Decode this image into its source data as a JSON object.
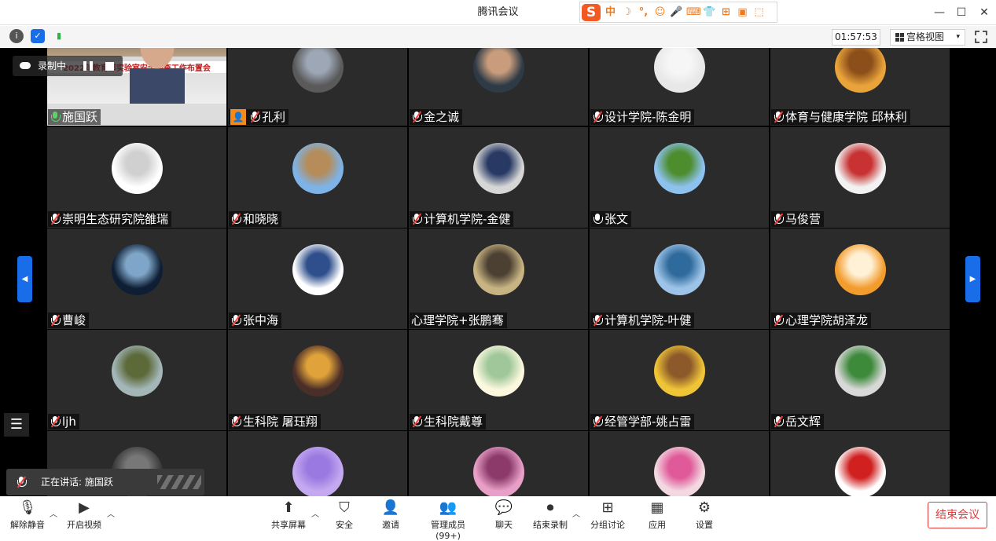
{
  "window": {
    "title": "腾讯会议",
    "minimize": "—",
    "maximize": "☐",
    "close": "✕"
  },
  "ime": {
    "logo": "S",
    "items": [
      "中",
      "☽",
      "°,",
      "☺",
      "🎤",
      "⌨",
      "👕",
      "⊞",
      "▣",
      "⬚"
    ]
  },
  "infobar": {
    "timer": "01:57:53",
    "view_label": "宫格视图",
    "view_caret": "▾"
  },
  "recording": {
    "label": "录制中"
  },
  "speaking": {
    "label": "正在讲话: 施国跃"
  },
  "colors": {
    "accent": "#1a6de8",
    "end": "#e03c3c",
    "mic_active": "#5fcf6a",
    "mic_muted": "#f04040"
  },
  "participants": [
    {
      "name": "施国跃",
      "mic": "on",
      "video": true,
      "slide_title": "2022年教育部实验室安全检查工作布置会"
    },
    {
      "name": "孔利",
      "mic": "off",
      "avatar": [
        "#5a5a5a",
        "#9da7b6"
      ],
      "badge": true
    },
    {
      "name": "金之诚",
      "mic": "off",
      "avatar": [
        "#2e3a46",
        "#c89c7c"
      ]
    },
    {
      "name": "设计学院-陈金明",
      "mic": "off",
      "avatar": [
        "#e8e8e8",
        "#f6f6f6"
      ]
    },
    {
      "name": "体育与健康学院 邱林利",
      "mic": "off",
      "avatar": [
        "#e8a33a",
        "#8c4e1a"
      ]
    },
    {
      "name": "崇明生态研究院雒瑞",
      "mic": "off",
      "avatar": [
        "#ffffff",
        "#d0d0d0"
      ]
    },
    {
      "name": "和晓晓",
      "mic": "off",
      "avatar": [
        "#7db3e6",
        "#b58c5a"
      ]
    },
    {
      "name": "计算机学院-金健",
      "mic": "off",
      "avatar": [
        "#d6d6d6",
        "#283a64"
      ]
    },
    {
      "name": "张文",
      "mic": "on-white",
      "avatar": [
        "#8dc2ef",
        "#4d8d2e"
      ]
    },
    {
      "name": "马俊营",
      "mic": "off",
      "avatar": [
        "#f2f2f2",
        "#c83232"
      ]
    },
    {
      "name": "曹峻",
      "mic": "off",
      "avatar": [
        "#0e1e34",
        "#7fa6c8"
      ]
    },
    {
      "name": "张中海",
      "mic": "off",
      "avatar": [
        "#ffffff",
        "#2e4f8c"
      ]
    },
    {
      "name": "心理学院+张鹏骞",
      "mic": "none",
      "avatar": [
        "#c7b482",
        "#4c4032"
      ]
    },
    {
      "name": "计算机学院-叶健",
      "mic": "off",
      "avatar": [
        "#9dc4e8",
        "#2f6a9c"
      ]
    },
    {
      "name": "心理学院胡泽龙",
      "mic": "off",
      "avatar": [
        "#f39c2e",
        "#fff1d6"
      ]
    },
    {
      "name": "ljh",
      "mic": "off",
      "avatar": [
        "#a4b6b8",
        "#5c6a3a"
      ]
    },
    {
      "name": "生科院 屠珏翔",
      "mic": "off",
      "avatar": [
        "#4a2e28",
        "#e0a23a"
      ]
    },
    {
      "name": "生科院戴尊",
      "mic": "off",
      "avatar": [
        "#fbf8de",
        "#9fc79a"
      ]
    },
    {
      "name": "经管学部-姚占雷",
      "mic": "off",
      "avatar": [
        "#f0c437",
        "#8c5a2a"
      ]
    },
    {
      "name": "岳文辉",
      "mic": "off",
      "avatar": [
        "#d8d8d8",
        "#3c8a3a"
      ]
    },
    {
      "name": "",
      "mic": "none",
      "avatar": [
        "#3a3a3a",
        "#777777"
      ]
    },
    {
      "name": "",
      "mic": "none",
      "avatar": [
        "#c4a8f0",
        "#9a7ae0"
      ]
    },
    {
      "name": "",
      "mic": "none",
      "avatar": [
        "#e8a0c8",
        "#8c3a6a"
      ]
    },
    {
      "name": "",
      "mic": "none",
      "avatar": [
        "#f2d8e0",
        "#e05a9a"
      ]
    },
    {
      "name": "",
      "mic": "none",
      "avatar": [
        "#ffffff",
        "#d02020"
      ]
    }
  ],
  "toolbar": {
    "unmute": "解除静音",
    "start_video": "开启视频",
    "share": "共享屏幕",
    "security": "安全",
    "invite": "邀请",
    "members": "管理成员(99+)",
    "chat": "聊天",
    "end_record": "结束录制",
    "breakout": "分组讨论",
    "apps": "应用",
    "settings": "设置",
    "end_meeting": "结束会议"
  }
}
